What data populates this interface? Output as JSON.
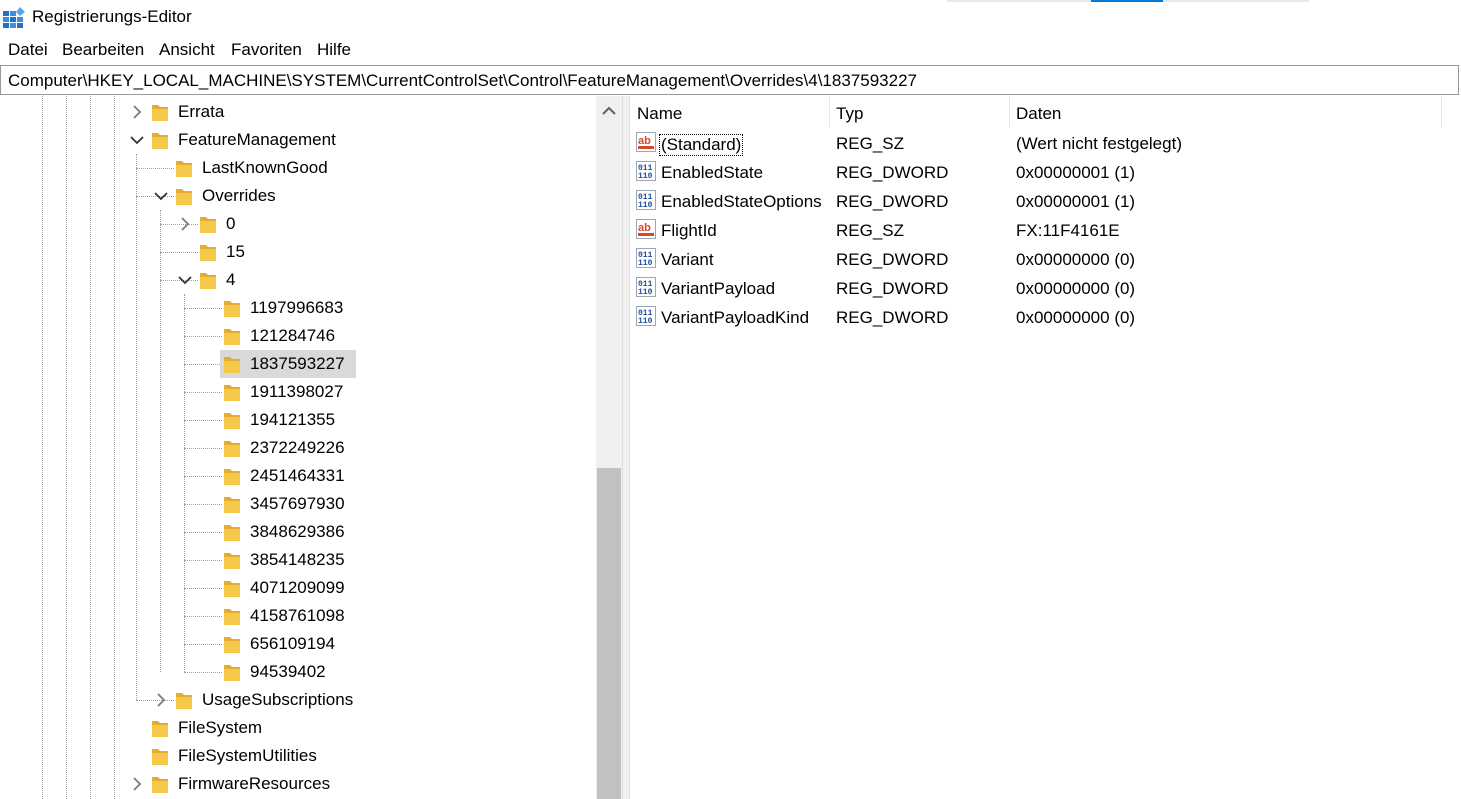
{
  "window": {
    "title": "Registrierungs-Editor"
  },
  "menu": [
    "Datei",
    "Bearbeiten",
    "Ansicht",
    "Favoriten",
    "Hilfe"
  ],
  "address": "Computer\\HKEY_LOCAL_MACHINE\\SYSTEM\\CurrentControlSet\\Control\\FeatureManagement\\Overrides\\4\\1837593227",
  "tree": {
    "nodes": [
      {
        "label": "Errata",
        "expander": "collapsed",
        "level": 0
      },
      {
        "label": "FeatureManagement",
        "expander": "expanded",
        "level": 0
      },
      {
        "label": "LastKnownGood",
        "expander": "none",
        "level": 1
      },
      {
        "label": "Overrides",
        "expander": "expanded",
        "level": 1
      },
      {
        "label": "0",
        "expander": "collapsed",
        "level": 2
      },
      {
        "label": "15",
        "expander": "none",
        "level": 2
      },
      {
        "label": "4",
        "expander": "expanded",
        "level": 2
      },
      {
        "label": "1197996683",
        "expander": "none",
        "level": 3
      },
      {
        "label": "121284746",
        "expander": "none",
        "level": 3
      },
      {
        "label": "1837593227",
        "expander": "none",
        "level": 3,
        "selected": true
      },
      {
        "label": "1911398027",
        "expander": "none",
        "level": 3
      },
      {
        "label": "194121355",
        "expander": "none",
        "level": 3
      },
      {
        "label": "2372249226",
        "expander": "none",
        "level": 3
      },
      {
        "label": "2451464331",
        "expander": "none",
        "level": 3
      },
      {
        "label": "3457697930",
        "expander": "none",
        "level": 3
      },
      {
        "label": "3848629386",
        "expander": "none",
        "level": 3
      },
      {
        "label": "3854148235",
        "expander": "none",
        "level": 3
      },
      {
        "label": "4071209099",
        "expander": "none",
        "level": 3
      },
      {
        "label": "4158761098",
        "expander": "none",
        "level": 3
      },
      {
        "label": "656109194",
        "expander": "none",
        "level": 3
      },
      {
        "label": "94539402",
        "expander": "none",
        "level": 3
      },
      {
        "label": "UsageSubscriptions",
        "expander": "collapsed",
        "level": 1
      },
      {
        "label": "FileSystem",
        "expander": "none",
        "level": 0
      },
      {
        "label": "FileSystemUtilities",
        "expander": "none",
        "level": 0
      },
      {
        "label": "FirmwareResources",
        "expander": "collapsed",
        "level": 0
      }
    ]
  },
  "values_list": {
    "headers": {
      "name": "Name",
      "type": "Typ",
      "data": "Daten"
    },
    "rows": [
      {
        "name": "(Standard)",
        "type": "REG_SZ",
        "data": "(Wert nicht festgelegt)",
        "icon": "string-value-icon",
        "focused": true
      },
      {
        "name": "EnabledState",
        "type": "REG_DWORD",
        "data": "0x00000001 (1)",
        "icon": "binary-value-icon"
      },
      {
        "name": "EnabledStateOptions",
        "type": "REG_DWORD",
        "data": "0x00000001 (1)",
        "icon": "binary-value-icon"
      },
      {
        "name": "FlightId",
        "type": "REG_SZ",
        "data": "FX:11F4161E",
        "icon": "string-value-icon"
      },
      {
        "name": "Variant",
        "type": "REG_DWORD",
        "data": "0x00000000 (0)",
        "icon": "binary-value-icon"
      },
      {
        "name": "VariantPayload",
        "type": "REG_DWORD",
        "data": "0x00000000 (0)",
        "icon": "binary-value-icon"
      },
      {
        "name": "VariantPayloadKind",
        "type": "REG_DWORD",
        "data": "0x00000000 (0)",
        "icon": "binary-value-icon"
      }
    ]
  },
  "colors": {
    "selection": "#d9d9d9",
    "folder": "#f6c94b",
    "accent": "#0078d7"
  }
}
